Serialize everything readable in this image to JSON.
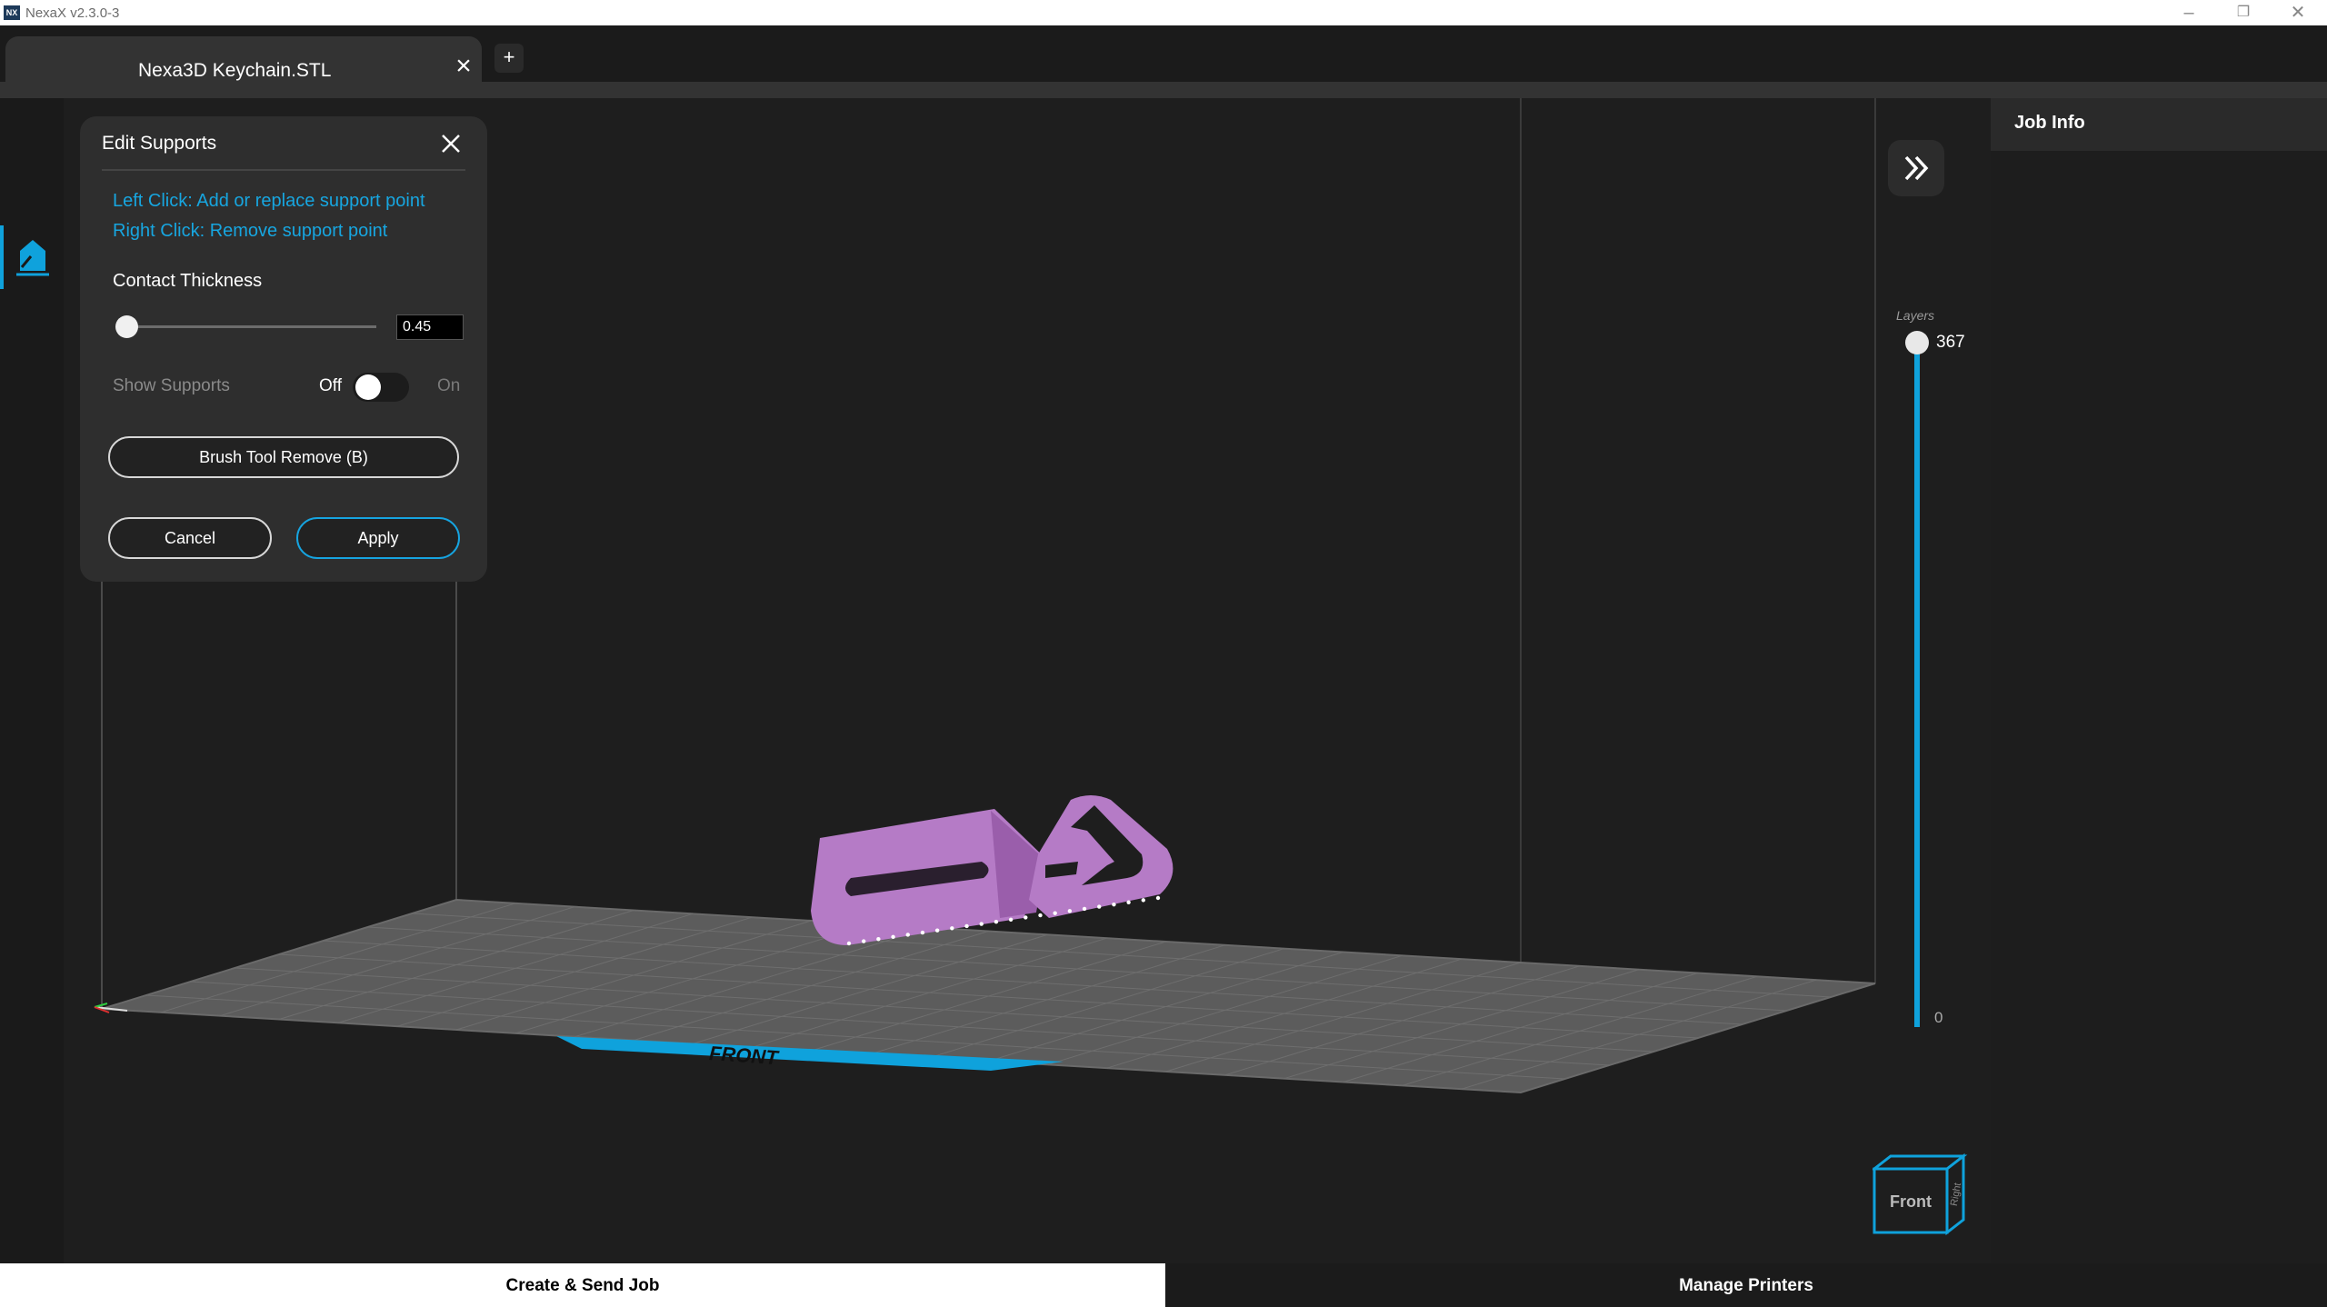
{
  "window": {
    "title": "NexaX v2.3.0-3",
    "icon_text": "NX",
    "minimize_icon": "minimize-icon",
    "maximize_icon": "restore-icon",
    "close_icon": "close-icon"
  },
  "tabs": {
    "active_tab": "Nexa3D Keychain.STL",
    "add_label": "+"
  },
  "edit_supports": {
    "title": "Edit Supports",
    "help_left": "Left Click: Add or replace support point",
    "help_right": "Right Click: Remove support point",
    "contact_thickness_label": "Contact Thickness",
    "contact_thickness_value": "0.45",
    "contact_thickness_slider_fraction": 0.0,
    "show_supports_label": "Show Supports",
    "off_label": "Off",
    "on_label": "On",
    "show_supports_on": false,
    "brush_button": "Brush Tool Remove (B)",
    "cancel_button": "Cancel",
    "apply_button": "Apply"
  },
  "layers": {
    "label": "Layers",
    "top": "367",
    "bottom": "0"
  },
  "viewport": {
    "front_label": "FRONT",
    "viewcube_front": "Front",
    "viewcube_right": "Right",
    "model_color": "#b57bc6",
    "accent_color": "#0fa2dc"
  },
  "job_info": {
    "title": "Job Info"
  },
  "bottom_tabs": {
    "create": "Create & Send Job",
    "manage": "Manage Printers"
  }
}
